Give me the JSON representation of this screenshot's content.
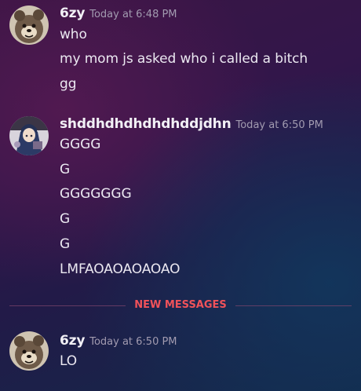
{
  "messages": [
    {
      "username": "6zy",
      "timestamp": "Today at 6:48 PM",
      "avatar_icon": "cartoon-bear-avatar",
      "lines": [
        "who",
        "my mom js asked who i called a bitch",
        "gg"
      ]
    },
    {
      "username": "shddhdhdhdhdhddjdhn",
      "timestamp": "Today at 6:50 PM",
      "avatar_icon": "anime-character-avatar",
      "lines": [
        "GGGG",
        "G",
        "GGGGGGG",
        "G",
        "G",
        "LMFAOAOAOAOAO"
      ]
    },
    {
      "username": "6zy",
      "timestamp": "Today at 6:50 PM",
      "avatar_icon": "cartoon-bear-avatar",
      "lines": [
        "LO"
      ]
    }
  ],
  "divider": {
    "label": "NEW MESSAGES",
    "color": "#f0525a"
  }
}
